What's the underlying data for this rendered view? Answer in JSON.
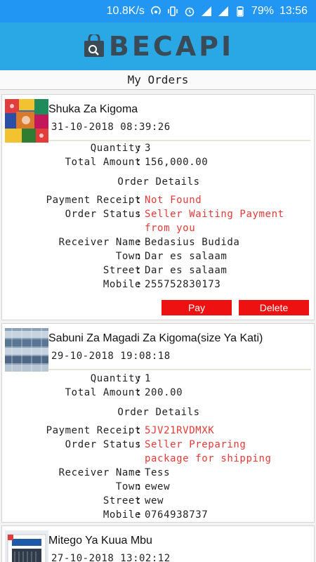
{
  "status_bar": {
    "speed": "10.8K/s",
    "battery": "79%",
    "time": "13:56"
  },
  "header": {
    "logo_text": "BECAPI"
  },
  "page": {
    "title": "My Orders"
  },
  "labels": {
    "quantity": "Quantity",
    "total_amount": "Total Amount",
    "order_details": "Order Details",
    "payment_receipt": "Payment Receipt",
    "order_status": "Order Status",
    "receiver_name": "Receiver Name",
    "town": "Town",
    "street": "Street",
    "mobile": "Mobile",
    "colon": ":"
  },
  "orders": [
    {
      "product_name": "Shuka Za Kigoma",
      "date": "31-10-2018 08:39:26",
      "quantity": "3",
      "total_amount": "156,000.00",
      "payment_receipt": "Not Found",
      "order_status_line1": "Seller Waiting Payment",
      "order_status_line2": "from you",
      "receiver_name": "Bedasius Budida",
      "town": "Dar es salaam",
      "street": "Dar es salaam",
      "mobile": "255752830173",
      "pay_label": "Pay",
      "delete_label": "Delete"
    },
    {
      "product_name": "Sabuni Za Magadi Za Kigoma(size Ya Kati)",
      "date": "29-10-2018 19:08:18",
      "quantity": "1",
      "total_amount": "200.00",
      "payment_receipt": "5JV21RVDMXK",
      "order_status_line1": "Seller Preparing",
      "order_status_line2": "package for shipping",
      "receiver_name": "Tess",
      "town": "ewew",
      "street": "wew",
      "mobile": "0764938737"
    },
    {
      "product_name": "Mitego Ya Kuua Mbu",
      "date": "27-10-2018 13:02:12"
    }
  ]
}
